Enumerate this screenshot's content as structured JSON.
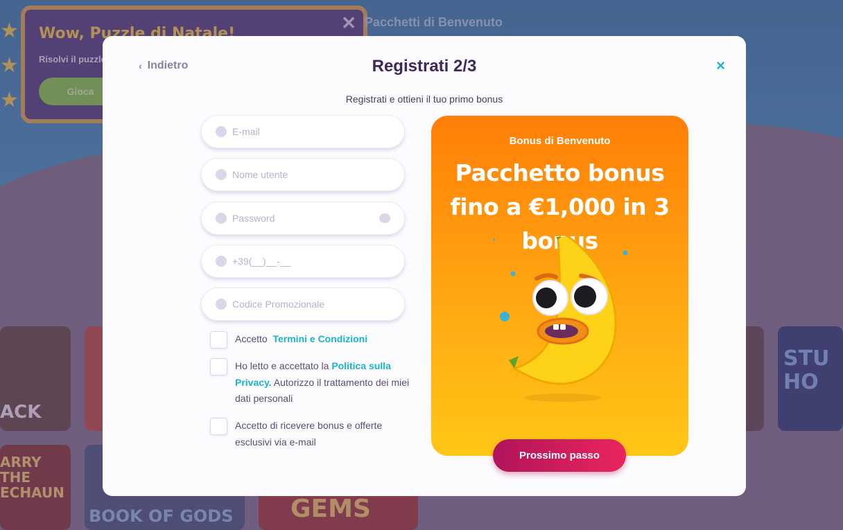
{
  "background": {
    "puzzle_title": "Wow, Puzzle di Natale!",
    "puzzle_subtitle": "Risolvi il puzzle",
    "puzzle_button": "Gioca",
    "nav_text": "Pacchetti di Benvenuto",
    "tiles": [
      {
        "label": "ACK"
      },
      {
        "label": "ARRY THE ECHAUN"
      },
      {
        "label": "BOOK OF GODS"
      },
      {
        "label": "GEMS"
      },
      {
        "label": "STU HO"
      }
    ]
  },
  "modal": {
    "back_label": "Indietro",
    "title": "Registrati 2/3",
    "subtitle": "Registrati e ottieni il tuo primo bonus",
    "close_symbol": "×",
    "fields": {
      "email_placeholder": "E-mail",
      "username_placeholder": "Nome utente",
      "password_placeholder": "Password",
      "phone_placeholder": "+39(__)__-__",
      "promo_placeholder": "Codice Promozionale"
    },
    "checks": {
      "terms_prefix": "Accetto",
      "terms_link": "Termini e Condizioni",
      "privacy_prefix": "Ho letto e accettato la",
      "privacy_link": "Politica sulla Privacy.",
      "privacy_suffix": "Autorizzo il trattamento dei miei dati personali",
      "marketing": "Accetto di ricevere bonus e offerte esclusivi via e-mail"
    },
    "promo": {
      "label": "Bonus di Benvenuto",
      "title": "Pacchetto bonus fino a €1,000 in 3 bonus"
    },
    "next_button": "Prossimo passo"
  },
  "colors": {
    "accent_link": "#19b3cc",
    "title": "#3e2a5a",
    "next_button": "#c81a5c",
    "promo_orange": "#ff8a0a"
  }
}
